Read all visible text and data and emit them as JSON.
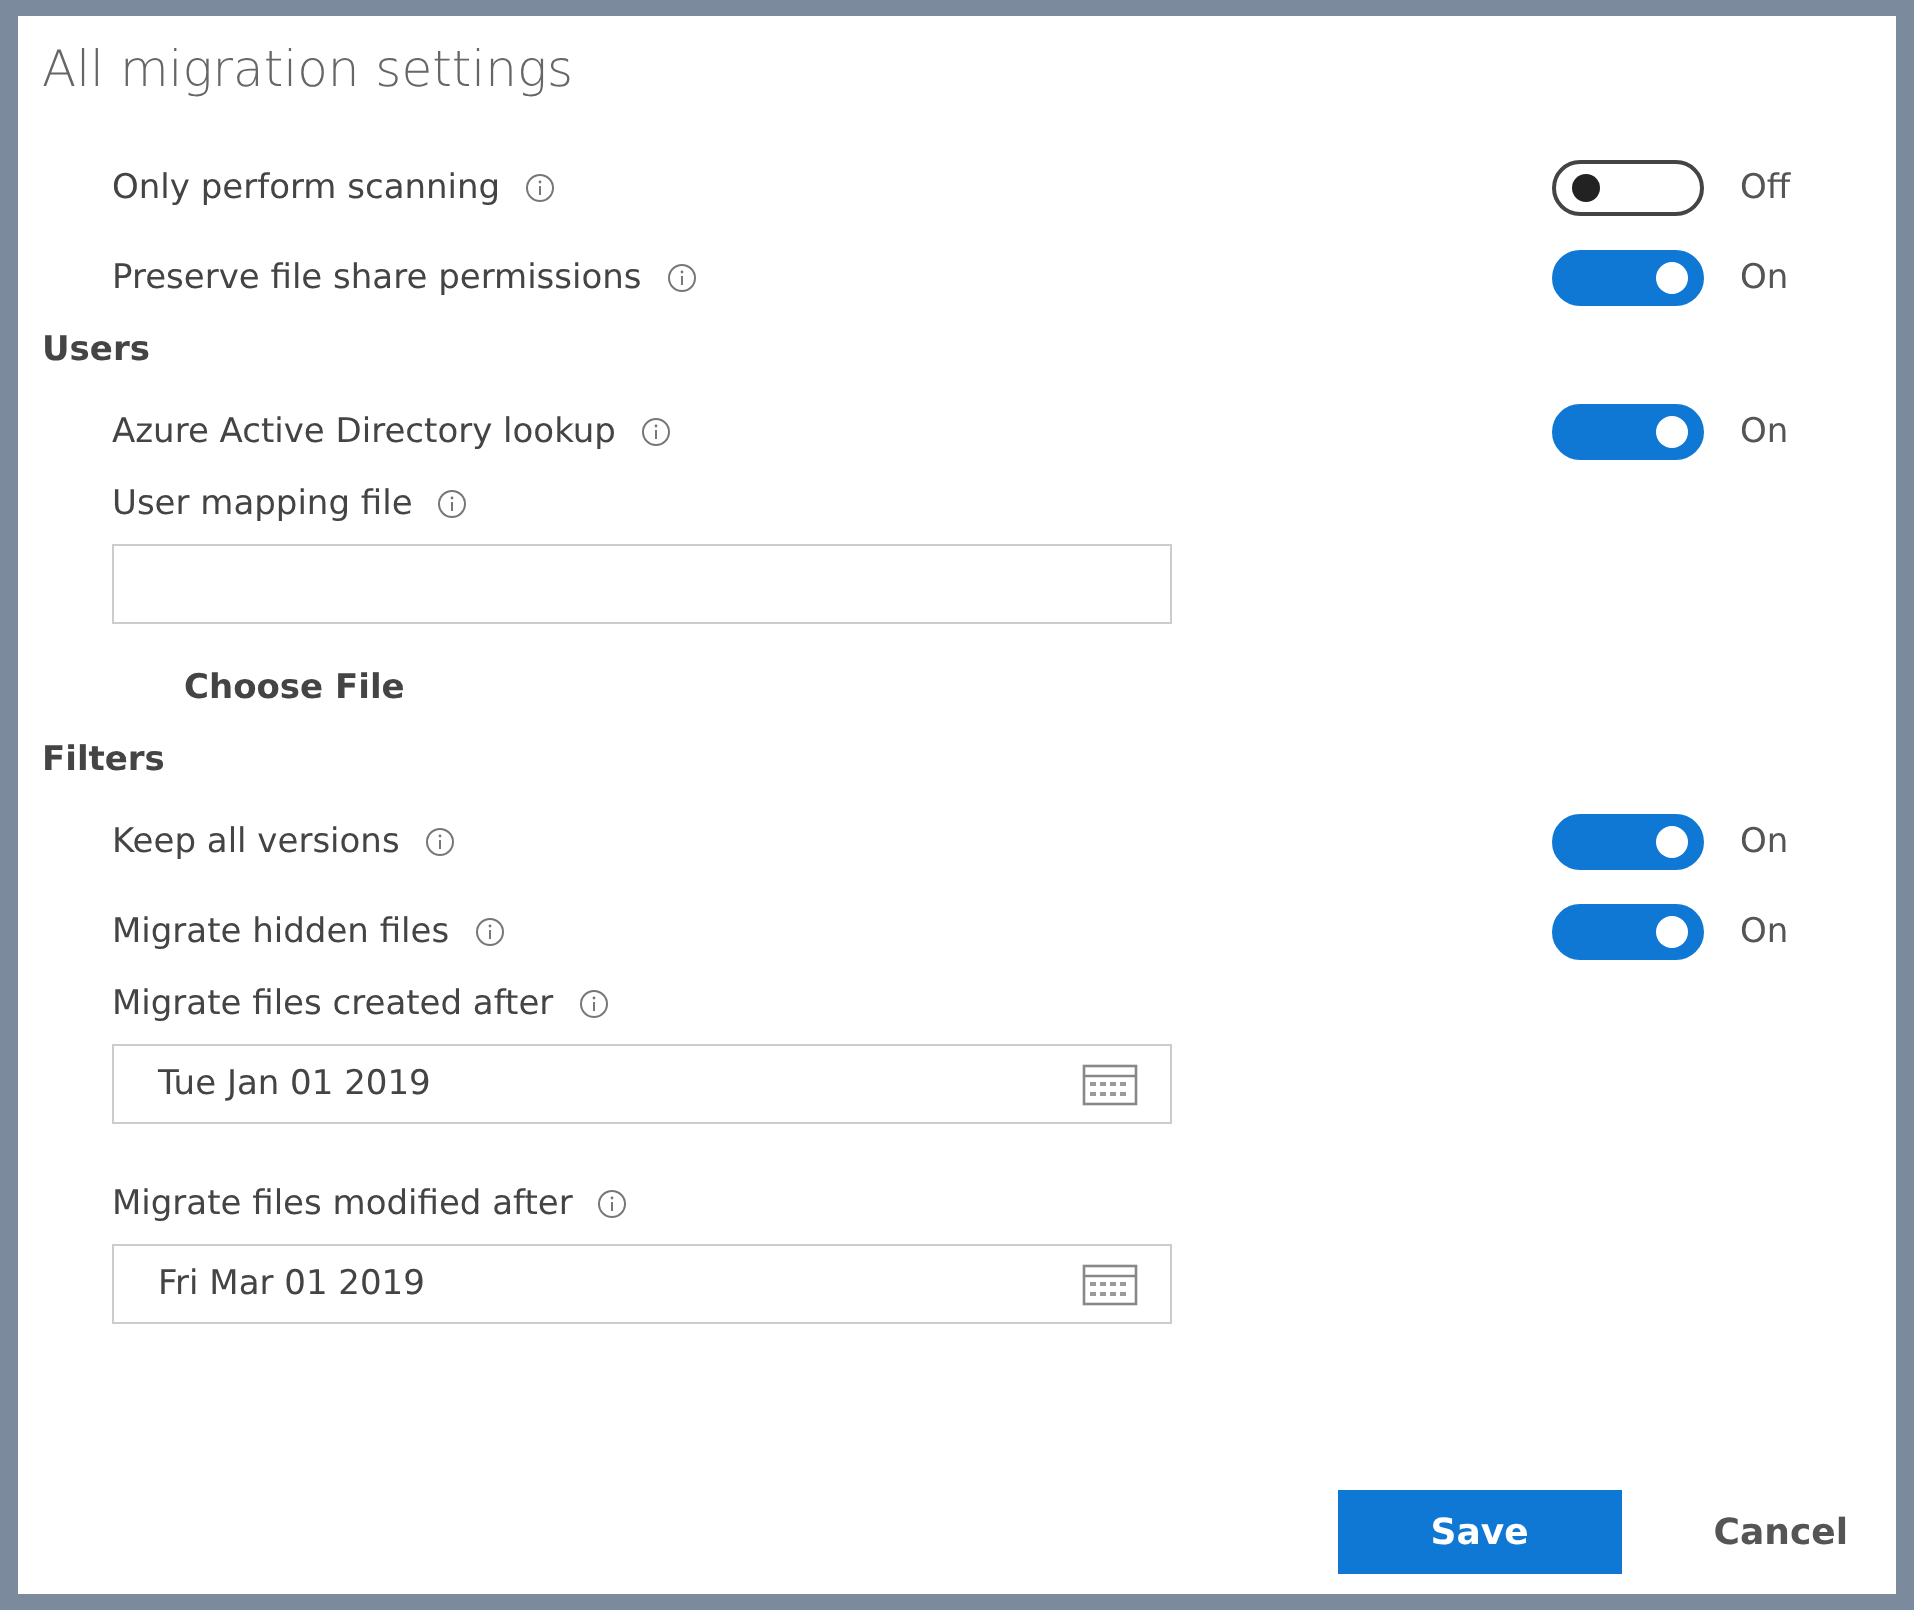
{
  "title": "All migration settings",
  "sections": [
    {
      "items": [
        {
          "kind": "toggle",
          "label": "Only perform scanning",
          "on": false,
          "state_text": "Off"
        },
        {
          "kind": "toggle",
          "label": "Preserve file share permissions",
          "on": true,
          "state_text": "On"
        }
      ]
    },
    {
      "heading": "Users",
      "items": [
        {
          "kind": "toggle",
          "label": "Azure Active Directory lookup",
          "on": true,
          "state_text": "On"
        },
        {
          "kind": "file",
          "label": "User mapping file",
          "button": "Choose File"
        }
      ]
    },
    {
      "heading": "Filters",
      "items": [
        {
          "kind": "toggle",
          "label": "Keep all versions",
          "on": true,
          "state_text": "On"
        },
        {
          "kind": "toggle",
          "label": "Migrate hidden files",
          "on": true,
          "state_text": "On"
        },
        {
          "kind": "date",
          "label": "Migrate files created after",
          "value": "Tue Jan 01 2019"
        },
        {
          "kind": "date",
          "label": "Migrate files modified after",
          "value": "Fri Mar 01 2019"
        }
      ]
    }
  ],
  "buttons": [
    {
      "label": "Save",
      "kind": "primary"
    },
    {
      "label": "Cancel",
      "kind": "plain"
    }
  ]
}
